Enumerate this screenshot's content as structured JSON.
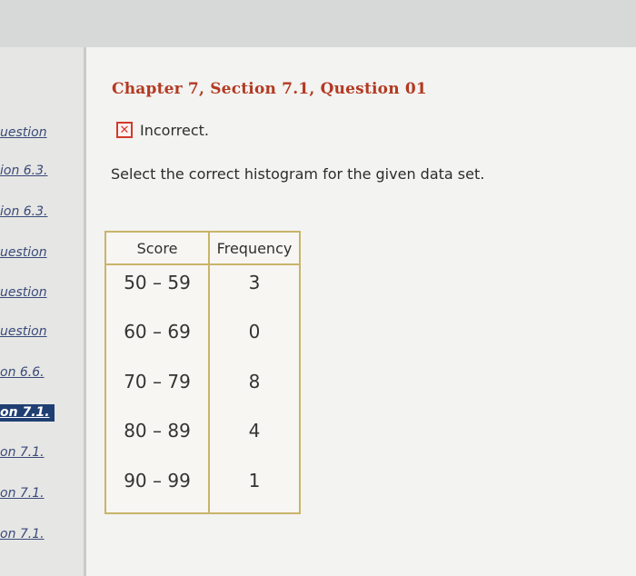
{
  "sidebar": {
    "items": [
      {
        "label": "uestion"
      },
      {
        "label": "ion 6.3."
      },
      {
        "label": "ion 6.3."
      },
      {
        "label": "uestion"
      },
      {
        "label": "uestion"
      },
      {
        "label": "uestion"
      },
      {
        "label": "on 6.6."
      },
      {
        "label": "on 7.1.",
        "active": true
      },
      {
        "label": "on 7.1."
      },
      {
        "label": "on 7.1."
      },
      {
        "label": "on 7.1."
      }
    ]
  },
  "main": {
    "title": "Chapter 7, Section 7.1, Question 01",
    "status": "Incorrect.",
    "prompt": "Select the correct histogram for the given data set.",
    "table": {
      "headers": [
        "Score",
        "Frequency"
      ],
      "rows": [
        [
          "50 – 59",
          "3"
        ],
        [
          "60 – 69",
          "0"
        ],
        [
          "70 – 79",
          "8"
        ],
        [
          "80 – 89",
          "4"
        ],
        [
          "90 – 99",
          "1"
        ]
      ]
    }
  },
  "colors": {
    "title": "#b33a22",
    "incorrect": "#d23a2a",
    "table_border": "#c9b46a",
    "active_nav": "#1f3f73"
  }
}
